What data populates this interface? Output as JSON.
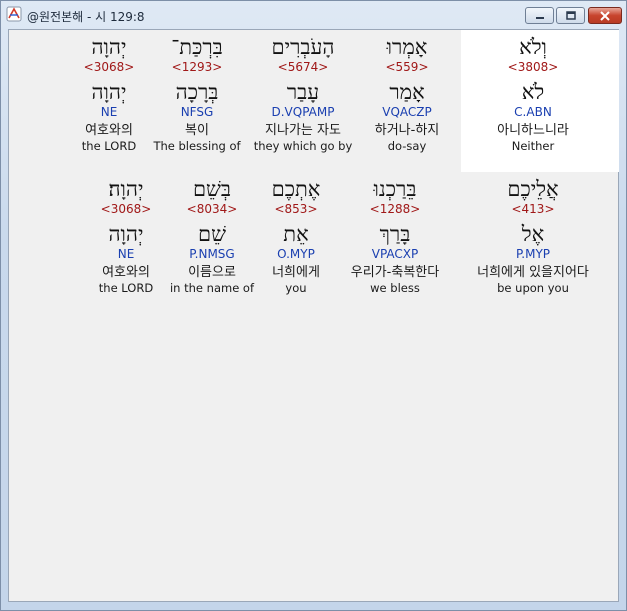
{
  "window": {
    "title": "@원전본해 - 시 129:8",
    "icon": "app-logo-icon",
    "controls": [
      "minimize-icon",
      "maximize-icon",
      "close-icon"
    ],
    "colors": {
      "strong": "#a01818",
      "morph": "#1a3fb0",
      "selected_bg": "#ffffff"
    }
  },
  "rows": [
    {
      "words": [
        {
          "hebrew": "וְלֹא",
          "strong": "<3808>",
          "lexeme": "לֹא",
          "morph": "C.ABN",
          "korean": "아니하느니라",
          "english": "Neither",
          "selected": true
        },
        {
          "hebrew": "אָמְרוּ",
          "strong": "<559>",
          "lexeme": "אָמַר",
          "morph": "VQACZP",
          "korean": "하거나-하지",
          "english": "do-say"
        },
        {
          "hebrew": "הָעֹבְרִים",
          "strong": "<5674>",
          "lexeme": "עָבַר",
          "morph": "D.VQPAMP",
          "korean": "지나가는 자도",
          "english": "they which go by"
        },
        {
          "hebrew": "בִּרְכַּת־",
          "strong": "<1293>",
          "lexeme": "בְּרָכָה",
          "morph": "NFSG",
          "korean": "복이",
          "english": "The blessing of"
        },
        {
          "hebrew": "יְהוָה",
          "strong": "<3068>",
          "lexeme": "יְהוָה",
          "morph": "NE",
          "korean": "여호와의",
          "english": "the LORD"
        }
      ]
    },
    {
      "words": [
        {
          "hebrew": "אֲלֵיכֶם",
          "strong": "<413>",
          "lexeme": "אֶל",
          "morph": "P.MYP",
          "korean": "너희에게 있을지어다",
          "english": "be upon you"
        },
        {
          "hebrew": "בֵּרַכְנוּ",
          "strong": "<1288>",
          "lexeme": "בָּרַךְ",
          "morph": "VPACXP",
          "korean": "우리가-축복한다",
          "english": "we bless"
        },
        {
          "hebrew": "אֶתְכֶם",
          "strong": "<853>",
          "lexeme": "אֵת",
          "morph": "O.MYP",
          "korean": "너희에게",
          "english": "you"
        },
        {
          "hebrew": "בְּשֵׁם",
          "strong": "<8034>",
          "lexeme": "שֵׁם",
          "morph": "P.NMSG",
          "korean": "이름으로",
          "english": "in the name of"
        },
        {
          "hebrew": "יְהוָה׃",
          "strong": "<3068>",
          "lexeme": "יְהוָה",
          "morph": "NE",
          "korean": "여호와의",
          "english": "the LORD"
        }
      ]
    }
  ]
}
